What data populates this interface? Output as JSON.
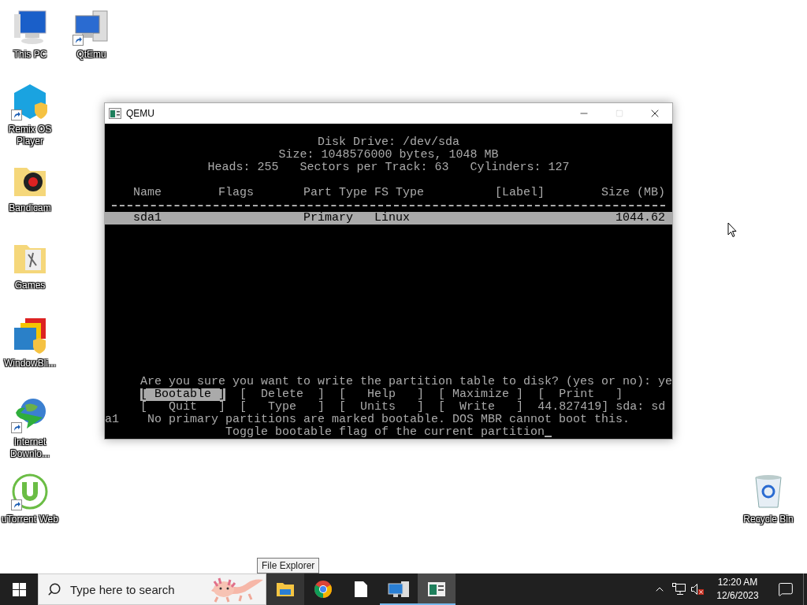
{
  "desktop_icons": [
    {
      "label": "This PC",
      "kind": "pc",
      "shortcut": false
    },
    {
      "label": "QtEmu",
      "kind": "tower",
      "shortcut": true
    },
    {
      "label": "Remix OS Player",
      "kind": "remix",
      "shortcut": true
    },
    {
      "label": "Bandicam",
      "kind": "folder-record",
      "shortcut": false
    },
    {
      "label": "Games",
      "kind": "folder",
      "shortcut": false
    },
    {
      "label": "WindowBli...",
      "kind": "windows",
      "shortcut": false
    },
    {
      "label": "Internet Downlo...",
      "kind": "globe",
      "shortcut": true
    },
    {
      "label": "uTorrent Web",
      "kind": "torrent",
      "shortcut": true
    },
    {
      "label": "Recycle Bin",
      "kind": "bin",
      "shortcut": false
    }
  ],
  "window": {
    "title": "QEMU",
    "maximize_disabled": true,
    "terminal": {
      "header": [
        "Disk Drive: /dev/sda",
        "Size: 1048576000 bytes, 1048 MB",
        "Heads: 255   Sectors per Track: 63   Cylinders: 127"
      ],
      "columns": [
        "Name",
        "Flags",
        "Part Type",
        "FS Type",
        "[Label]",
        "Size (MB)"
      ],
      "rows": [
        {
          "cells": [
            "sda1",
            "",
            "Primary",
            "Linux",
            "",
            "1044.62"
          ],
          "selected": true
        }
      ],
      "prompt": "Are you sure you want to write the partition table to disk? (yes or no): ye",
      "menu": [
        [
          {
            "label": "[ Bootable ]",
            "selected": true
          },
          {
            "label": "[  Delete  ]",
            "selected": false
          },
          {
            "label": "[   Help   ]",
            "selected": false
          },
          {
            "label": "[ Maximize ]",
            "selected": false
          },
          {
            "label": "[  Print   ]",
            "selected": false
          }
        ],
        [
          {
            "label": "[   Quit   ]",
            "selected": false
          },
          {
            "label": "[   Type   ]",
            "selected": false
          },
          {
            "label": "[  Units   ]",
            "selected": false
          },
          {
            "label": "[  Write   ]",
            "selected": false
          }
        ]
      ],
      "menu_tail": "44.827419] sda: sd",
      "message": "a1    No primary partitions are marked bootable. DOS MBR cannot boot this.",
      "hint": "Toggle bootable flag of the current partition",
      "cursor": true
    }
  },
  "tooltip": "File Explorer",
  "taskbar": {
    "search": {
      "placeholder": "Type here to search"
    },
    "apps": [
      {
        "kind": "folder",
        "hovered": true,
        "running": false,
        "selected": false
      },
      {
        "kind": "chrome",
        "hovered": false,
        "running": false,
        "selected": false
      },
      {
        "kind": "file",
        "hovered": false,
        "running": false,
        "selected": false
      },
      {
        "kind": "tower",
        "hovered": false,
        "running": true,
        "selected": false
      },
      {
        "kind": "qemu",
        "hovered": false,
        "running": true,
        "selected": true
      }
    ],
    "volume_muted": true,
    "time": "12:20 AM",
    "date": "12/6/2023"
  }
}
